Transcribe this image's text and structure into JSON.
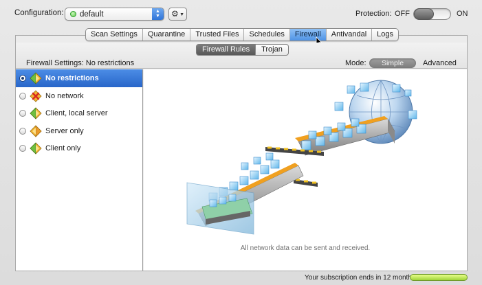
{
  "toolbar": {
    "configuration_label": "Configuration:",
    "configuration_value": "default",
    "protection_label": "Protection:",
    "protection_off": "OFF",
    "protection_on": "ON",
    "protection_state": "off"
  },
  "tabs": [
    {
      "label": "Scan Settings",
      "active": false
    },
    {
      "label": "Quarantine",
      "active": false
    },
    {
      "label": "Trusted Files",
      "active": false
    },
    {
      "label": "Schedules",
      "active": false
    },
    {
      "label": "Firewall",
      "active": true
    },
    {
      "label": "Antivandal",
      "active": false
    },
    {
      "label": "Logs",
      "active": false
    }
  ],
  "subtabs": [
    {
      "label": "Firewall Rules",
      "active": true
    },
    {
      "label": "Trojan",
      "active": false
    }
  ],
  "firewall": {
    "settings_text": "Firewall Settings:  No restrictions",
    "mode_label": "Mode:",
    "mode_simple": "Simple",
    "mode_advanced": "Advanced",
    "options": [
      {
        "label": "No restrictions",
        "selected": true,
        "icon": "shield-diamond-icon"
      },
      {
        "label": "No network",
        "selected": false,
        "icon": "shield-blocked-icon"
      },
      {
        "label": "Client, local server",
        "selected": false,
        "icon": "shield-diamond-icon"
      },
      {
        "label": "Server only",
        "selected": false,
        "icon": "shield-diamond-icon"
      },
      {
        "label": "Client only",
        "selected": false,
        "icon": "shield-diamond-icon"
      }
    ],
    "caption": "All network data can be sent and received."
  },
  "status": {
    "subscription_text": "Your subscription ends in 12 months",
    "subscription_fraction": 1.0
  },
  "colors": {
    "accent_blue": "#2f74d8",
    "selection_blue": "#3a7bd8",
    "status_green": "#9fd33a"
  }
}
